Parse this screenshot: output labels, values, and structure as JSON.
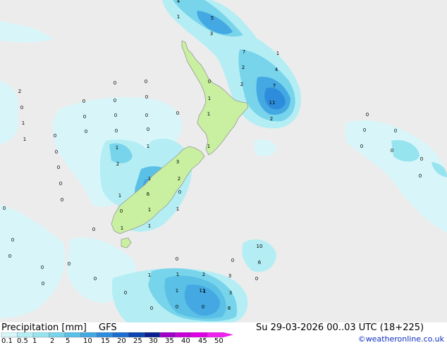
{
  "footer": {
    "left_label": "Precipitation [mm]",
    "model": "GFS",
    "valid_time": "Su 29-03-2026 00..03 UTC (18+225)",
    "credit": "©weatheronline.co.uk"
  },
  "colorbar": {
    "ticks": [
      "0.1",
      "0.5",
      "1",
      "2",
      "5",
      "10",
      "15",
      "20",
      "25",
      "30",
      "35",
      "40",
      "45",
      "50"
    ],
    "colors": [
      "#d8f6fa",
      "#b4eef4",
      "#96e4ee",
      "#78d4ea",
      "#5ac0e6",
      "#44a8e2",
      "#2e8cdc",
      "#1c6cd0",
      "#0c44b0",
      "#0a1f90",
      "#a000c8",
      "#c800d8",
      "#e000e8",
      "#f020f0"
    ]
  },
  "map": {
    "land_color": "#c8f0a0",
    "background_color": "#ececec",
    "value_labels": [
      "4",
      "1",
      "5",
      "3",
      "7",
      "1",
      "2",
      "4",
      "2",
      "7",
      "11",
      "2",
      "0",
      "1",
      "1",
      "0",
      "0",
      "0",
      "0",
      "0",
      "0",
      "0",
      "0",
      "0",
      "0",
      "0",
      "0",
      "0",
      "1",
      "1",
      "1",
      "2",
      "3",
      "1",
      "2",
      "6",
      "1",
      "0",
      "0",
      "1",
      "1",
      "1",
      "1",
      "2",
      "0",
      "1",
      "1",
      "0",
      "0",
      "0",
      "0",
      "0",
      "0",
      "0",
      "0",
      "0",
      "0",
      "0",
      "0",
      "0",
      "1",
      "1",
      "0",
      "0",
      "1",
      "2",
      "1",
      "3",
      "0",
      "0",
      "8",
      "11",
      "0",
      "3",
      "10",
      "6",
      "0",
      "0",
      "0",
      "0",
      "0",
      "0",
      "0",
      "0"
    ]
  }
}
